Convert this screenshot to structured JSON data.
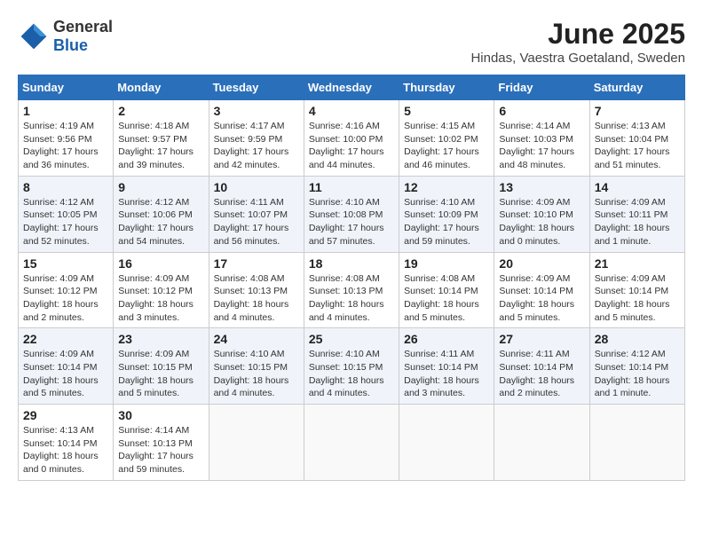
{
  "header": {
    "logo_general": "General",
    "logo_blue": "Blue",
    "month_title": "June 2025",
    "location": "Hindas, Vaestra Goetaland, Sweden"
  },
  "days_of_week": [
    "Sunday",
    "Monday",
    "Tuesday",
    "Wednesday",
    "Thursday",
    "Friday",
    "Saturday"
  ],
  "weeks": [
    [
      {
        "day": "1",
        "info": "Sunrise: 4:19 AM\nSunset: 9:56 PM\nDaylight: 17 hours\nand 36 minutes."
      },
      {
        "day": "2",
        "info": "Sunrise: 4:18 AM\nSunset: 9:57 PM\nDaylight: 17 hours\nand 39 minutes."
      },
      {
        "day": "3",
        "info": "Sunrise: 4:17 AM\nSunset: 9:59 PM\nDaylight: 17 hours\nand 42 minutes."
      },
      {
        "day": "4",
        "info": "Sunrise: 4:16 AM\nSunset: 10:00 PM\nDaylight: 17 hours\nand 44 minutes."
      },
      {
        "day": "5",
        "info": "Sunrise: 4:15 AM\nSunset: 10:02 PM\nDaylight: 17 hours\nand 46 minutes."
      },
      {
        "day": "6",
        "info": "Sunrise: 4:14 AM\nSunset: 10:03 PM\nDaylight: 17 hours\nand 48 minutes."
      },
      {
        "day": "7",
        "info": "Sunrise: 4:13 AM\nSunset: 10:04 PM\nDaylight: 17 hours\nand 51 minutes."
      }
    ],
    [
      {
        "day": "8",
        "info": "Sunrise: 4:12 AM\nSunset: 10:05 PM\nDaylight: 17 hours\nand 52 minutes."
      },
      {
        "day": "9",
        "info": "Sunrise: 4:12 AM\nSunset: 10:06 PM\nDaylight: 17 hours\nand 54 minutes."
      },
      {
        "day": "10",
        "info": "Sunrise: 4:11 AM\nSunset: 10:07 PM\nDaylight: 17 hours\nand 56 minutes."
      },
      {
        "day": "11",
        "info": "Sunrise: 4:10 AM\nSunset: 10:08 PM\nDaylight: 17 hours\nand 57 minutes."
      },
      {
        "day": "12",
        "info": "Sunrise: 4:10 AM\nSunset: 10:09 PM\nDaylight: 17 hours\nand 59 minutes."
      },
      {
        "day": "13",
        "info": "Sunrise: 4:09 AM\nSunset: 10:10 PM\nDaylight: 18 hours\nand 0 minutes."
      },
      {
        "day": "14",
        "info": "Sunrise: 4:09 AM\nSunset: 10:11 PM\nDaylight: 18 hours\nand 1 minute."
      }
    ],
    [
      {
        "day": "15",
        "info": "Sunrise: 4:09 AM\nSunset: 10:12 PM\nDaylight: 18 hours\nand 2 minutes."
      },
      {
        "day": "16",
        "info": "Sunrise: 4:09 AM\nSunset: 10:12 PM\nDaylight: 18 hours\nand 3 minutes."
      },
      {
        "day": "17",
        "info": "Sunrise: 4:08 AM\nSunset: 10:13 PM\nDaylight: 18 hours\nand 4 minutes."
      },
      {
        "day": "18",
        "info": "Sunrise: 4:08 AM\nSunset: 10:13 PM\nDaylight: 18 hours\nand 4 minutes."
      },
      {
        "day": "19",
        "info": "Sunrise: 4:08 AM\nSunset: 10:14 PM\nDaylight: 18 hours\nand 5 minutes."
      },
      {
        "day": "20",
        "info": "Sunrise: 4:09 AM\nSunset: 10:14 PM\nDaylight: 18 hours\nand 5 minutes."
      },
      {
        "day": "21",
        "info": "Sunrise: 4:09 AM\nSunset: 10:14 PM\nDaylight: 18 hours\nand 5 minutes."
      }
    ],
    [
      {
        "day": "22",
        "info": "Sunrise: 4:09 AM\nSunset: 10:14 PM\nDaylight: 18 hours\nand 5 minutes."
      },
      {
        "day": "23",
        "info": "Sunrise: 4:09 AM\nSunset: 10:15 PM\nDaylight: 18 hours\nand 5 minutes."
      },
      {
        "day": "24",
        "info": "Sunrise: 4:10 AM\nSunset: 10:15 PM\nDaylight: 18 hours\nand 4 minutes."
      },
      {
        "day": "25",
        "info": "Sunrise: 4:10 AM\nSunset: 10:15 PM\nDaylight: 18 hours\nand 4 minutes."
      },
      {
        "day": "26",
        "info": "Sunrise: 4:11 AM\nSunset: 10:14 PM\nDaylight: 18 hours\nand 3 minutes."
      },
      {
        "day": "27",
        "info": "Sunrise: 4:11 AM\nSunset: 10:14 PM\nDaylight: 18 hours\nand 2 minutes."
      },
      {
        "day": "28",
        "info": "Sunrise: 4:12 AM\nSunset: 10:14 PM\nDaylight: 18 hours\nand 1 minute."
      }
    ],
    [
      {
        "day": "29",
        "info": "Sunrise: 4:13 AM\nSunset: 10:14 PM\nDaylight: 18 hours\nand 0 minutes."
      },
      {
        "day": "30",
        "info": "Sunrise: 4:14 AM\nSunset: 10:13 PM\nDaylight: 17 hours\nand 59 minutes."
      },
      {
        "day": "",
        "info": ""
      },
      {
        "day": "",
        "info": ""
      },
      {
        "day": "",
        "info": ""
      },
      {
        "day": "",
        "info": ""
      },
      {
        "day": "",
        "info": ""
      }
    ]
  ]
}
